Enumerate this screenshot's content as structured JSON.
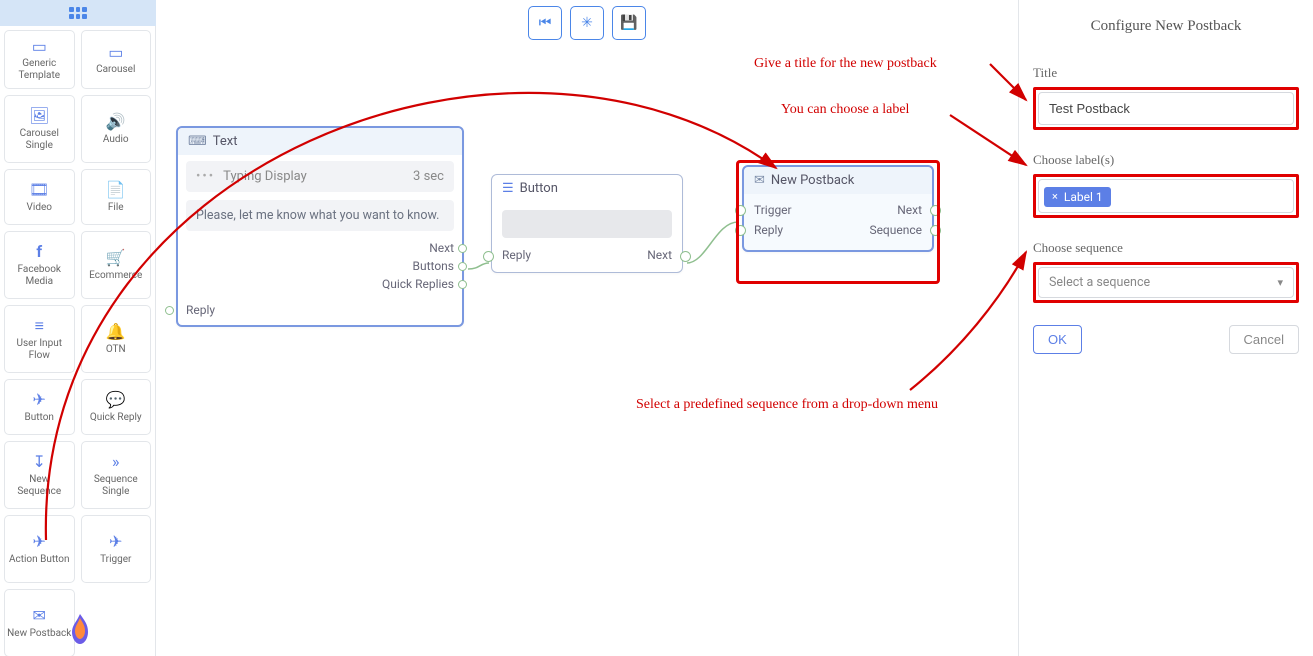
{
  "toolbar": {
    "grid": "apps-icon"
  },
  "sidebar": {
    "items": [
      {
        "label": "Generic Template",
        "icon": "▭"
      },
      {
        "label": "Carousel",
        "icon": "▭"
      },
      {
        "label": "Carousel Single",
        "icon": "🖼"
      },
      {
        "label": "Audio",
        "icon": "🔊"
      },
      {
        "label": "Video",
        "icon": "🎞"
      },
      {
        "label": "File",
        "icon": "📄"
      },
      {
        "label": "Facebook Media",
        "icon": "f"
      },
      {
        "label": "Ecommerce",
        "icon": "🛒"
      },
      {
        "label": "User Input Flow",
        "icon": "≡"
      },
      {
        "label": "OTN",
        "icon": "🔔"
      },
      {
        "label": "Button",
        "icon": "✈"
      },
      {
        "label": "Quick Reply",
        "icon": "💬"
      },
      {
        "label": "New Sequence",
        "icon": "↧"
      },
      {
        "label": "Sequence Single",
        "icon": "»"
      },
      {
        "label": "Action Button",
        "icon": "✈"
      },
      {
        "label": "Trigger",
        "icon": "✈"
      },
      {
        "label": "New Postback",
        "icon": "✉"
      }
    ]
  },
  "canvas": {
    "toolbar": {
      "rewind": "⏮",
      "center": "⤫",
      "save": "💾"
    },
    "text_node": {
      "title": "Text",
      "typing_label": "Typing Display",
      "typing_time": "3 sec",
      "content": "Please, let me know what you want to know.",
      "ports_right": [
        "Next",
        "Buttons",
        "Quick Replies"
      ],
      "port_left": "Reply"
    },
    "button_node": {
      "title": "Button",
      "port_left": "Reply",
      "port_right": "Next"
    },
    "postback_node": {
      "title": "New Postback",
      "rows": [
        {
          "left": "Trigger",
          "right": "Next"
        },
        {
          "left": "Reply",
          "right": "Sequence"
        }
      ]
    }
  },
  "annotations": {
    "title_hint": "Give a title for the new postback",
    "label_hint": "You can choose a label",
    "sequence_hint": "Select a predefined sequence from a drop-down menu"
  },
  "panel": {
    "heading": "Configure New Postback",
    "title_label": "Title",
    "title_value": "Test Postback",
    "labels_label": "Choose label(s)",
    "chip": "Label 1",
    "sequence_label": "Choose sequence",
    "sequence_placeholder": "Select a sequence",
    "ok": "OK",
    "cancel": "Cancel"
  }
}
